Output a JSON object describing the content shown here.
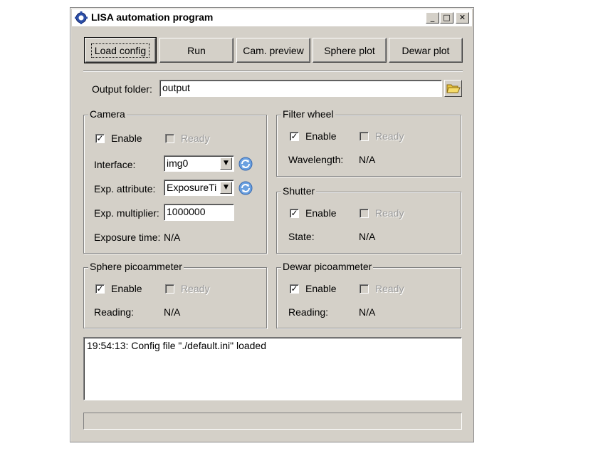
{
  "window": {
    "title": "LISA automation program",
    "minimize": "_",
    "maximize": "□",
    "close": "✕"
  },
  "toolbar": {
    "load_config": "Load config",
    "run": "Run",
    "cam_preview": "Cam. preview",
    "sphere_plot": "Sphere plot",
    "dewar_plot": "Dewar plot"
  },
  "output": {
    "label": "Output folder:",
    "value": "output"
  },
  "camera": {
    "title": "Camera",
    "enable": "Enable",
    "enable_checked": true,
    "ready": "Ready",
    "interface_label": "Interface:",
    "interface_value": "img0",
    "exp_attr_label": "Exp. attribute:",
    "exp_attr_value": "ExposureTi",
    "exp_mult_label": "Exp. multiplier:",
    "exp_mult_value": "1000000",
    "exposure_label": "Exposure time:",
    "exposure_value": "N/A"
  },
  "filter_wheel": {
    "title": "Filter wheel",
    "enable": "Enable",
    "ready": "Ready",
    "wavelength_label": "Wavelength:",
    "wavelength_value": "N/A"
  },
  "shutter": {
    "title": "Shutter",
    "enable": "Enable",
    "ready": "Ready",
    "state_label": "State:",
    "state_value": "N/A"
  },
  "sphere_pico": {
    "title": "Sphere picoammeter",
    "enable": "Enable",
    "ready": "Ready",
    "reading_label": "Reading:",
    "reading_value": "N/A"
  },
  "dewar_pico": {
    "title": "Dewar picoammeter",
    "enable": "Enable",
    "ready": "Ready",
    "reading_label": "Reading:",
    "reading_value": "N/A"
  },
  "log": {
    "lines": [
      "19:54:13: Config file \"./default.ini\" loaded"
    ]
  },
  "status_bar": {
    "text": ""
  }
}
